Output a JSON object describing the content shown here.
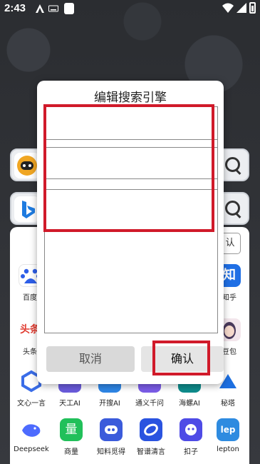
{
  "status": {
    "time": "2:43"
  },
  "dialog": {
    "title": "编辑搜索引擎",
    "cancel_label": "取消",
    "confirm_label": "确认"
  },
  "sheet": {
    "confirm_label": "认",
    "row1": [
      {
        "label": "百度",
        "icon": "baidu-icon",
        "color": "#2d5ee8"
      },
      {
        "label": "知乎",
        "icon": "zhihu-icon",
        "color": "#1f6fe5"
      }
    ],
    "row2": [
      {
        "label": "头条",
        "icon": "toutiao-icon",
        "color": "#e03a2f"
      },
      {
        "label": "豆包",
        "icon": "doubao-icon",
        "color": "#f0d5df"
      }
    ],
    "ai_row": [
      {
        "label": "文心一言",
        "icon": "wenxin-icon",
        "color": "#3a6de8"
      },
      {
        "label": "天工AI",
        "icon": "tiangong-icon",
        "color": "#6a5bdc"
      },
      {
        "label": "开搜AI",
        "icon": "kaisou-icon",
        "color": "#2e86e6"
      },
      {
        "label": "通义千问",
        "icon": "tongyi-icon",
        "color": "#7b5ce8"
      },
      {
        "label": "海螺AI",
        "icon": "hailuo-icon",
        "color": "#0e8c8c"
      },
      {
        "label": "秘塔",
        "icon": "mita-icon",
        "color": "#1d6fe0"
      }
    ],
    "bottom_row": [
      {
        "label": "Deepseek",
        "icon": "deepseek-icon",
        "color": "#4d6bfe"
      },
      {
        "label": "商量",
        "icon": "shangliang-icon",
        "color": "#21c05a"
      },
      {
        "label": "知料觅得",
        "icon": "zhiliao-icon",
        "color": "#3b5bdb"
      },
      {
        "label": "智谱清言",
        "icon": "zhipu-icon",
        "color": "#2a53e0"
      },
      {
        "label": "扣子",
        "icon": "kouzi-icon",
        "color": "#4e4be6"
      },
      {
        "label": "lepton",
        "icon": "lepton-icon",
        "color": "#2e8be0"
      }
    ]
  }
}
